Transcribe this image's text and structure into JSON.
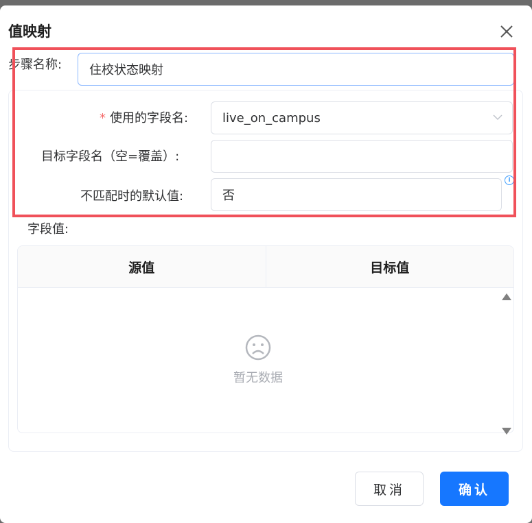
{
  "dialog": {
    "title": "值映射",
    "close_icon": "close-icon"
  },
  "form": {
    "step_name_label": "步骤名称:",
    "step_name_value": "住校状态映射",
    "field_name_label": "使用的字段名:",
    "field_name_required_mark": "*",
    "field_name_value": "live_on_campus",
    "target_field_label": "目标字段名（空=覆盖）:",
    "target_field_value": "",
    "default_value_label": "不匹配时的默认值:",
    "default_value_value": "否",
    "info_icon": "info-icon",
    "info_glyph": "i"
  },
  "field_values": {
    "label": "字段值:",
    "columns": [
      "源值",
      "目标值"
    ],
    "empty_text": "暂无数据",
    "empty_icon": "sad-face-icon"
  },
  "footer": {
    "cancel_label": "取消",
    "confirm_label": "确认"
  },
  "colors": {
    "primary": "#1677ff",
    "highlight_box": "#f0515a",
    "required": "#f56c6c"
  }
}
